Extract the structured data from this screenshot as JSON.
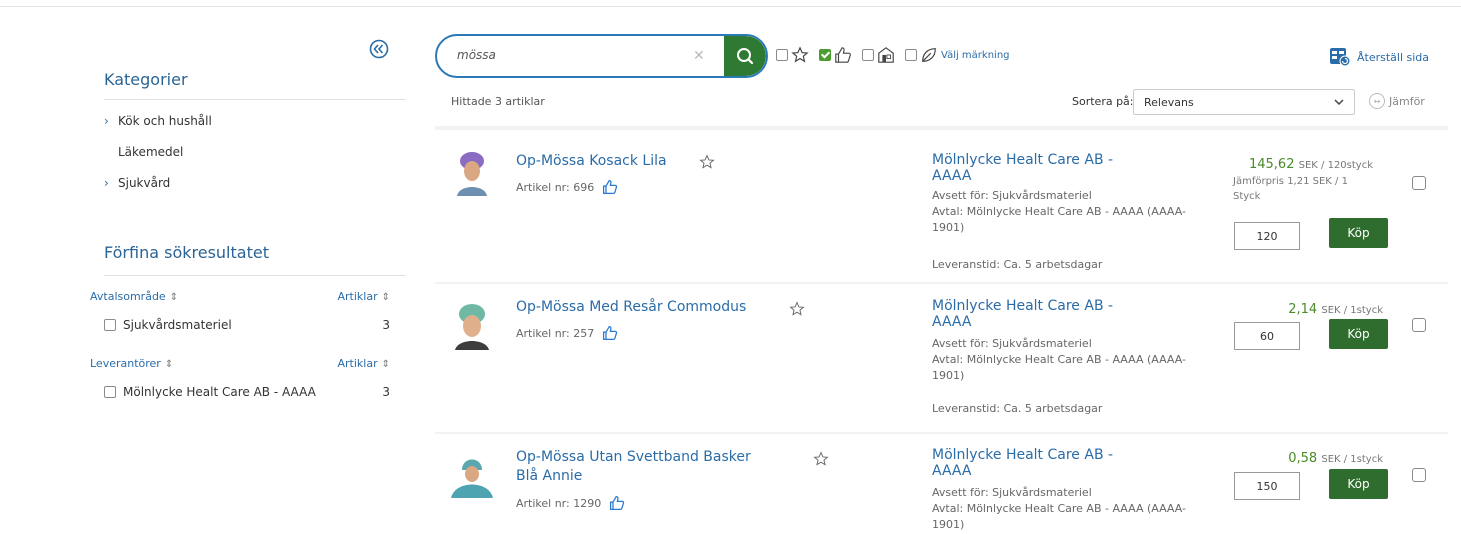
{
  "sidebar": {
    "categories_title": "Kategorier",
    "categories": [
      {
        "label": "Kök och hushåll",
        "expandable": true
      },
      {
        "label": "Läkemedel",
        "expandable": false
      },
      {
        "label": "Sjukvård",
        "expandable": true
      }
    ],
    "refine_title": "Förfina sökresultatet",
    "facets": [
      {
        "title": "Avtalsområde",
        "count_header": "Artiklar",
        "options": [
          {
            "label": "Sjukvårdsmateriel",
            "count": "3"
          }
        ]
      },
      {
        "title": "Leverantörer",
        "count_header": "Artiklar",
        "options": [
          {
            "label": "Mölnlycke Healt Care AB - AAAA",
            "count": "3"
          }
        ]
      }
    ]
  },
  "search": {
    "value": "mössa",
    "placeholder": ""
  },
  "filters": {
    "label_marking": "Välj märkning"
  },
  "toolbar": {
    "reset_label": "Återställ sida",
    "found_text": "Hittade 3 artiklar",
    "sort_label": "Sortera på:",
    "sort_value": "Relevans",
    "compare_label": "Jämför"
  },
  "products": [
    {
      "title_lines": [
        "Op-Mössa Kosack Lila"
      ],
      "article_nr": "Artikel nr: 696",
      "supplier_lines": [
        "Mölnlycke Healt Care AB -",
        "AAAA"
      ],
      "meta_lines": [
        "Avsett för: Sjukvårdsmateriel",
        "Avtal: Mölnlycke Healt Care AB - AAAA (AAAA-",
        "1901)"
      ],
      "delivery": "Leveranstid: Ca. 5 arbetsdagar",
      "price": "145,62",
      "price_unit": "SEK / 120styck",
      "compare_lines": [
        "Jämförpris  1,21 SEK / 1",
        "Styck"
      ],
      "quantity": "120",
      "buy_label": "Köp"
    },
    {
      "title_lines": [
        "Op-Mössa Med Resår Commodus"
      ],
      "article_nr": "Artikel nr: 257",
      "supplier_lines": [
        "Mölnlycke Healt Care AB -",
        "AAAA"
      ],
      "meta_lines": [
        "Avsett för: Sjukvårdsmateriel",
        "Avtal: Mölnlycke Healt Care AB - AAAA (AAAA-",
        "1901)"
      ],
      "delivery": "Leveranstid: Ca. 5 arbetsdagar",
      "price": "2,14",
      "price_unit": "SEK / 1styck",
      "compare_lines": [],
      "quantity": "60",
      "buy_label": "Köp"
    },
    {
      "title_lines": [
        "Op-Mössa Utan Svettband Basker",
        "Blå Annie"
      ],
      "article_nr": "Artikel nr: 1290",
      "supplier_lines": [
        "Mölnlycke Healt Care AB -",
        "AAAA"
      ],
      "meta_lines": [
        "Avsett för: Sjukvårdsmateriel",
        "Avtal: Mölnlycke Healt Care AB - AAAA (AAAA-",
        "1901)"
      ],
      "delivery": "",
      "price": "0,58",
      "price_unit": "SEK / 1styck",
      "compare_lines": [],
      "quantity": "150",
      "buy_label": "Köp"
    }
  ],
  "colors": {
    "accent": "#2a6ca8",
    "buy": "#2e6d2e",
    "price": "#4a8a2a",
    "search_button": "#2f7a33"
  },
  "icons": [
    "collapse-double-chevron-icon",
    "search-icon",
    "clear-icon",
    "star-icon",
    "thumbs-up-icon",
    "store-icon",
    "leaf-icon",
    "reset-page-icon",
    "compare-icon",
    "chevron-down-icon"
  ]
}
